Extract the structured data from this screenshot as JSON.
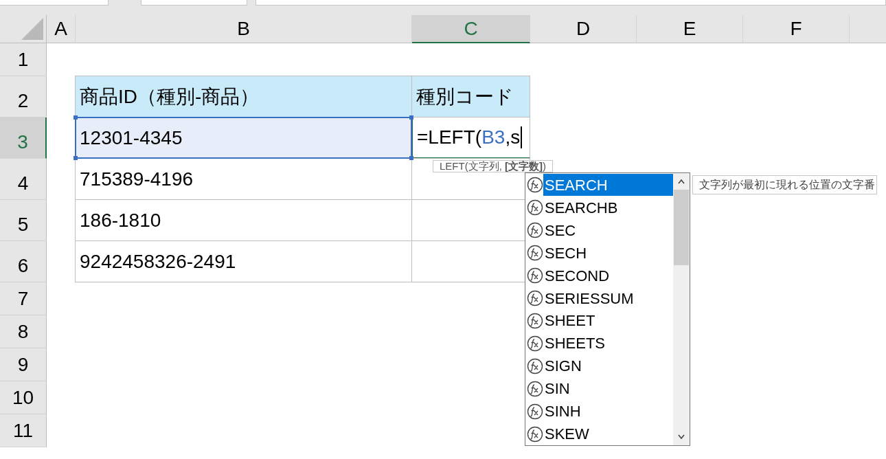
{
  "columns": [
    {
      "label": "A",
      "selected": false
    },
    {
      "label": "B",
      "selected": false
    },
    {
      "label": "C",
      "selected": true
    },
    {
      "label": "D",
      "selected": false
    },
    {
      "label": "E",
      "selected": false
    },
    {
      "label": "F",
      "selected": false
    }
  ],
  "rows": [
    {
      "number": "1",
      "selected": false,
      "cells": []
    },
    {
      "number": "2",
      "selected": false,
      "cells": [
        {
          "kind": "header",
          "text": "商品ID（種別-商品）"
        },
        {
          "kind": "header",
          "text": "種別コード"
        }
      ]
    },
    {
      "number": "3",
      "selected": true,
      "cells": [
        {
          "kind": "data",
          "text": "12301-4345",
          "selected": true
        },
        {
          "kind": "editing",
          "selected": false,
          "formula": [
            {
              "kind": "plain",
              "text": "=LEFT("
            },
            {
              "kind": "ref",
              "text": "B3"
            },
            {
              "kind": "plain",
              "text": ",s"
            }
          ]
        }
      ]
    },
    {
      "number": "4",
      "selected": false,
      "cells": [
        {
          "kind": "data",
          "text": "715389-4196",
          "selected": false
        },
        {
          "kind": "data",
          "selected": false
        }
      ]
    },
    {
      "number": "5",
      "selected": false,
      "cells": [
        {
          "kind": "data",
          "text": "186-1810",
          "selected": false
        },
        {
          "kind": "data",
          "selected": false
        }
      ]
    },
    {
      "number": "6",
      "selected": false,
      "cells": [
        {
          "kind": "data",
          "text": "9242458326-2491",
          "selected": false
        },
        {
          "kind": "data",
          "selected": false
        }
      ]
    },
    {
      "number": "7",
      "selected": false,
      "cells": []
    },
    {
      "number": "8",
      "selected": false,
      "cells": []
    },
    {
      "number": "9",
      "selected": false,
      "cells": []
    },
    {
      "number": "10",
      "selected": false,
      "cells": []
    },
    {
      "number": "11",
      "selected": false,
      "cells": []
    }
  ],
  "syntax_tip": "LEFT(文字列, **[文字数]**)",
  "autocomplete": {
    "items": [
      {
        "name": "SEARCH",
        "selected": true
      },
      {
        "name": "SEARCHB",
        "selected": false
      },
      {
        "name": "SEC",
        "selected": false
      },
      {
        "name": "SECH",
        "selected": false
      },
      {
        "name": "SECOND",
        "selected": false
      },
      {
        "name": "SERIESSUM",
        "selected": false
      },
      {
        "name": "SHEET",
        "selected": false
      },
      {
        "name": "SHEETS",
        "selected": false
      },
      {
        "name": "SIGN",
        "selected": false
      },
      {
        "name": "SIN",
        "selected": false
      },
      {
        "name": "SINH",
        "selected": false
      },
      {
        "name": "SKEW",
        "selected": false
      }
    ],
    "description": "文字列が最初に現れる位置の文字番"
  }
}
